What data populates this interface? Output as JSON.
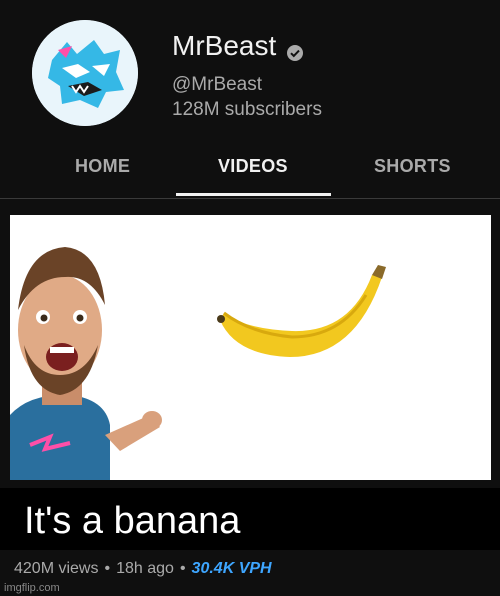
{
  "channel": {
    "name": "MrBeast",
    "handle": "@MrBeast",
    "subscribers": "128M subscribers",
    "verified_icon": "check-circle-icon"
  },
  "tabs": [
    {
      "label": "HOME",
      "active": false
    },
    {
      "label": "VIDEOS",
      "active": true
    },
    {
      "label": "SHORTS",
      "active": false
    }
  ],
  "video": {
    "title": "It's a banana",
    "views": "420M views",
    "age": "18h ago",
    "vph": "30.4K VPH"
  },
  "watermark": "imgflip.com",
  "colors": {
    "background": "#0f0f0f",
    "secondary_text": "#aaaaaa",
    "vph_blue": "#3ea6ff",
    "brand_blue": "#35b8e6",
    "banana_yellow": "#f2c81f"
  }
}
